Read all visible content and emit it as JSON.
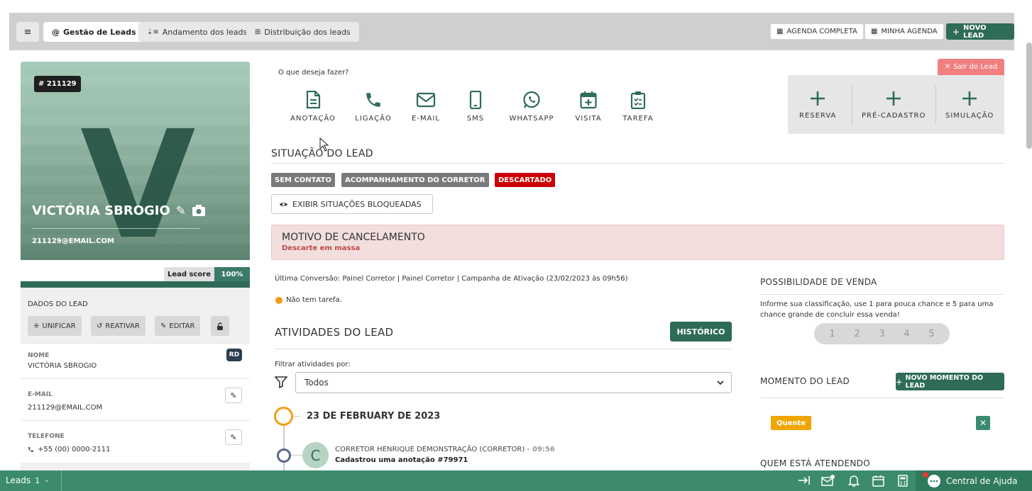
{
  "topbar": {
    "menu_icon": "hamburger-icon",
    "tabs": [
      {
        "label": "Gestão de Leads",
        "icon": "at-icon",
        "active": true
      },
      {
        "label": "Andamento dos leads",
        "icon": "sort-icon",
        "active": false
      },
      {
        "label": "Distribuição dos leads",
        "icon": "sitemap-icon",
        "active": false
      }
    ],
    "agenda_completa": "AGENDA COMPLETA",
    "minha_agenda": "MINHA AGENDA",
    "novo_lead": "NOVO LEAD"
  },
  "lead": {
    "id": "# 211129",
    "letter": "V",
    "name": "VICTÓRIA SBROGIO",
    "email": "211129@EMAIL.COM",
    "score_label": "Lead score",
    "score_value": "100%",
    "score_fraction": 1.0
  },
  "dados": {
    "title": "DADOS DO LEAD",
    "buttons": {
      "unificar": "UNIFICAR",
      "reativar": "REATIVAR",
      "editar": "EDITAR"
    },
    "fields": [
      {
        "label": "NOME",
        "value": "VICTÓRIA SBROGIO",
        "badge": "RD"
      },
      {
        "label": "E-MAIL",
        "value": "211129@EMAIL.COM"
      },
      {
        "label": "TELEFONE",
        "value": "+55 (00) 0000-2111"
      }
    ]
  },
  "actions": {
    "prompt": "O que deseja fazer?",
    "items": [
      "ANOTAÇÃO",
      "LIGAÇÃO",
      "E-MAIL",
      "SMS",
      "WHATSAPP",
      "VISITA",
      "TAREFA"
    ],
    "right_items": [
      "RESERVA",
      "PRÉ-CADASTRO",
      "SIMULAÇÃO"
    ],
    "sair": "Sair do Lead"
  },
  "situacao": {
    "title": "SITUAÇÃO DO LEAD",
    "tags": [
      {
        "label": "SEM CONTATO",
        "color": "#7a7a7a"
      },
      {
        "label": "ACOMPANHAMENTO DO CORRETOR",
        "color": "#7a7a7a"
      },
      {
        "label": "DESCARTADO",
        "color": "#cc0000"
      }
    ],
    "exibir": "EXIBIR SITUAÇÕES BLOQUEADAS"
  },
  "motivo": {
    "title": "MOTIVO DE CANCELAMENTO",
    "detail": "Descarte em massa"
  },
  "conversao": "Última Conversão: Painel Corretor | Painel Corretor | Campanha de Ativação (23/02/2023 às 09h56)",
  "tarefa": "Não tem tarefa.",
  "atividades": {
    "title": "ATIVIDADES DO LEAD",
    "historico": "HISTÓRICO",
    "filter_label": "Filtrar atividades por:",
    "filter_value": "Todos",
    "date": "23 DE FEBRUARY DE 2023",
    "entry_avatar": "C",
    "entry_author": "CORRETOR HENRIQUE DEMONSTRAÇÃO (CORRETOR) -",
    "entry_time": "09:56",
    "entry_text": "Cadastrou uma anotação #79971"
  },
  "possibilidade": {
    "title": "POSSIBILIDADE DE VENDA",
    "text": "Informe sua classificação, use 1 para pouca chance e 5 para uma chance grande de concluir essa venda!",
    "options": [
      "1",
      "2",
      "3",
      "4",
      "5"
    ]
  },
  "momento": {
    "title": "MOMENTO DO LEAD",
    "novo": "NOVO MOMENTO DO LEAD",
    "tag": "Quente",
    "remove": "✕"
  },
  "atendendo": {
    "title": "QUEM ESTÁ ATENDENDO"
  },
  "taskbar": {
    "leads": "Leads",
    "count": "1",
    "help": "Central de Ajuda"
  },
  "colors": {
    "brand": "#2e6b58",
    "taskbar": "#3c8c6c",
    "alert_bg": "#f3dede",
    "alert_text": "#b94a48",
    "orange": "#f0a500"
  }
}
